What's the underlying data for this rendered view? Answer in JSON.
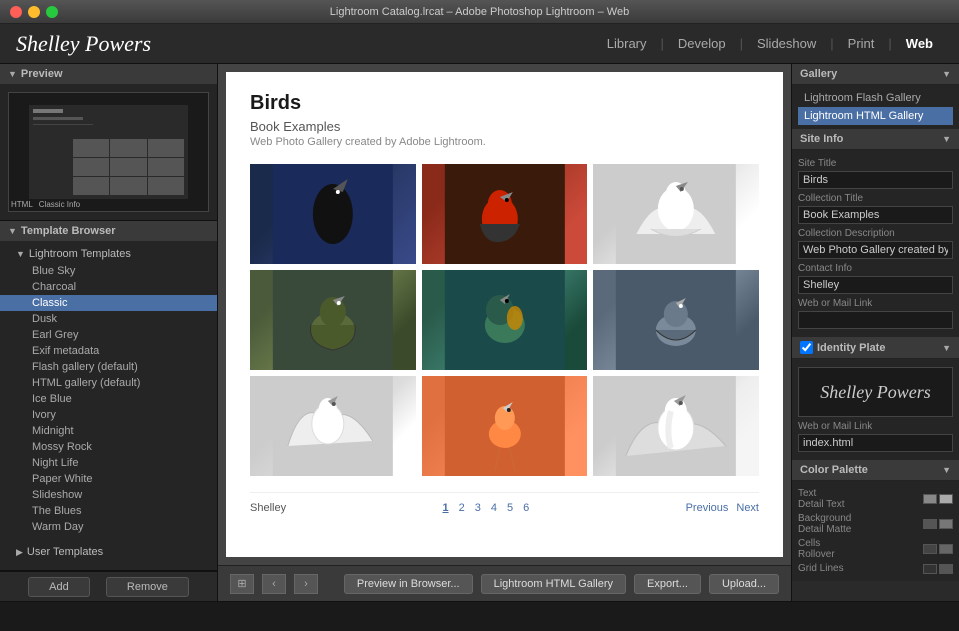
{
  "window": {
    "title": "Lightroom Catalog.lrcat – Adobe Photoshop Lightroom – Web",
    "buttons": [
      "close",
      "minimize",
      "maximize"
    ]
  },
  "topnav": {
    "logo": "Shelley Powers",
    "links": [
      {
        "id": "library",
        "label": "Library"
      },
      {
        "id": "develop",
        "label": "Develop"
      },
      {
        "id": "slideshow",
        "label": "Slideshow"
      },
      {
        "id": "print",
        "label": "Print"
      },
      {
        "id": "web",
        "label": "Web",
        "active": true
      }
    ]
  },
  "left_panel": {
    "preview_header": "Preview",
    "template_browser_header": "Template Browser",
    "add_button": "Add",
    "remove_button": "Remove",
    "lightroom_templates": {
      "label": "Lightroom Templates",
      "items": [
        "Blue Sky",
        "Charcoal",
        "Classic",
        "Dusk",
        "Earl Grey",
        "Exif metadata",
        "Flash gallery (default)",
        "HTML gallery (default)",
        "Ice Blue",
        "Ivory",
        "Midnight",
        "Mossy Rock",
        "Night Life",
        "Paper White",
        "Slideshow",
        "The Blues",
        "Warm Day"
      ],
      "selected": "Classic"
    },
    "user_templates": {
      "label": "User Templates"
    }
  },
  "gallery": {
    "title": "Birds",
    "subtitle": "Book Examples",
    "description": "Web Photo Gallery created by Adobe Lightroom.",
    "footer_name": "Shelley",
    "pages": [
      "1",
      "2",
      "3",
      "4",
      "5",
      "6"
    ],
    "current_page": "1",
    "nav_previous": "Previous",
    "nav_next": "Next",
    "photos": [
      {
        "id": "bird1",
        "class": "bird1"
      },
      {
        "id": "bird2",
        "class": "bird2"
      },
      {
        "id": "bird3",
        "class": "bird3"
      },
      {
        "id": "bird4",
        "class": "bird4"
      },
      {
        "id": "bird5",
        "class": "bird5"
      },
      {
        "id": "bird6",
        "class": "bird6"
      },
      {
        "id": "bird7",
        "class": "bird7"
      },
      {
        "id": "bird8",
        "class": "bird8"
      },
      {
        "id": "bird9",
        "class": "bird9"
      }
    ]
  },
  "center_bottom": {
    "preview_btn": "Preview in Browser...",
    "gallery_btn": "Lightroom HTML Gallery",
    "export_btn": "Export...",
    "upload_btn": "Upload..."
  },
  "right_panel": {
    "gallery_section": {
      "title": "Gallery",
      "options": [
        {
          "label": "Lightroom Flash Gallery",
          "selected": false
        },
        {
          "label": "Lightroom HTML Gallery",
          "selected": true
        }
      ]
    },
    "site_info_section": {
      "title": "Site Info",
      "site_title_label": "Site Title",
      "site_title_value": "Birds",
      "collection_title_label": "Collection Title",
      "collection_title_value": "Book Examples",
      "collection_desc_label": "Collection Description",
      "collection_desc_value": "Web Photo Gallery created by Adobe Lightroom.",
      "contact_info_label": "Contact Info",
      "contact_info_value": "Shelley",
      "web_mail_label": "Web or Mail Link",
      "web_mail_value": ""
    },
    "identity_plate_section": {
      "title": "Identity Plate",
      "plate_text": "Shelley Powers",
      "web_mail_label": "Web or Mail Link",
      "web_mail_value": "index.html"
    },
    "color_palette_section": {
      "title": "Color Palette",
      "rows": [
        {
          "label": "Text",
          "sub_label": "Detail Text",
          "swatches": [
            "#888888",
            "#aaaaaa"
          ]
        },
        {
          "label": "Background",
          "sub_label": "Detail Matte",
          "swatches": [
            "#555555",
            "#777777"
          ]
        },
        {
          "label": "Cells",
          "sub_label": "Rollover",
          "swatches": [
            "#444444",
            "#666666"
          ]
        },
        {
          "label": "",
          "sub_label": "Grid Lines",
          "swatches": [
            "#333333",
            "#555555"
          ]
        }
      ]
    }
  }
}
